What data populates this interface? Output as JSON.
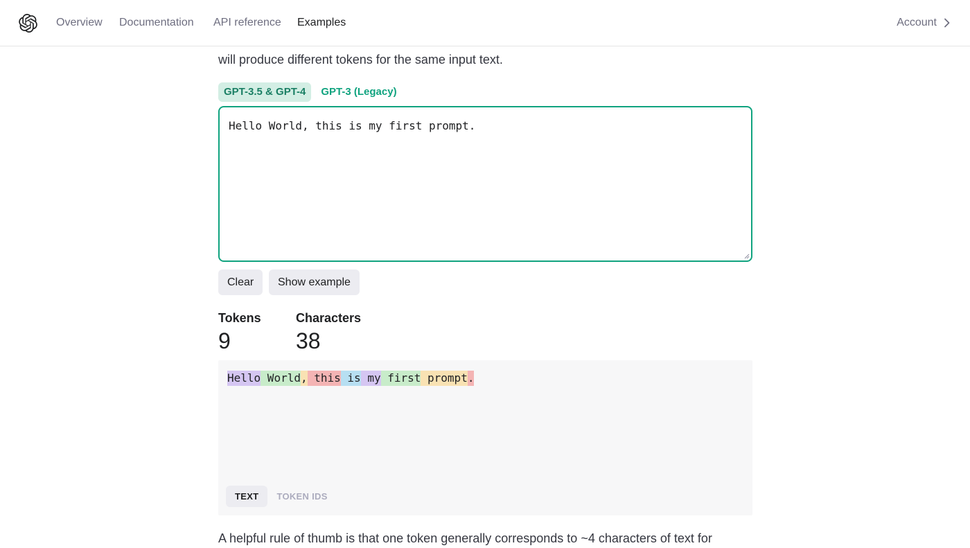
{
  "nav": {
    "links": [
      "Overview",
      "Documentation",
      "API reference",
      "Examples"
    ],
    "active": "Examples",
    "account_label": "Account"
  },
  "intro": {
    "line2": "will produce different tokens for the same input text."
  },
  "model_tabs": [
    "GPT-3.5 & GPT-4",
    "GPT-3 (Legacy)"
  ],
  "input": {
    "value": "Hello World, this is my first prompt."
  },
  "buttons": {
    "clear": "Clear",
    "show_example": "Show example"
  },
  "stats": {
    "tokens_label": "Tokens",
    "tokens_value": "9",
    "characters_label": "Characters",
    "characters_value": "38"
  },
  "tokens": [
    {
      "text": "Hello",
      "color": "#d5c6f2"
    },
    {
      "text": " World",
      "color": "#c8ecca"
    },
    {
      "text": ",",
      "color": "#f9e2b3"
    },
    {
      "text": " this",
      "color": "#f4b4b4"
    },
    {
      "text": " is",
      "color": "#b7dff2"
    },
    {
      "text": " my",
      "color": "#d5c6f2"
    },
    {
      "text": " first",
      "color": "#c8ecca"
    },
    {
      "text": " prompt",
      "color": "#f9e2b3"
    },
    {
      "text": ".",
      "color": "#f4b4b4"
    }
  ],
  "view_tabs": [
    "TEXT",
    "TOKEN IDS"
  ],
  "footer": {
    "text": "A helpful rule of thumb is that one token generally corresponds to ~4 characters of text for"
  },
  "colors": {
    "accent": "#10a37f"
  }
}
